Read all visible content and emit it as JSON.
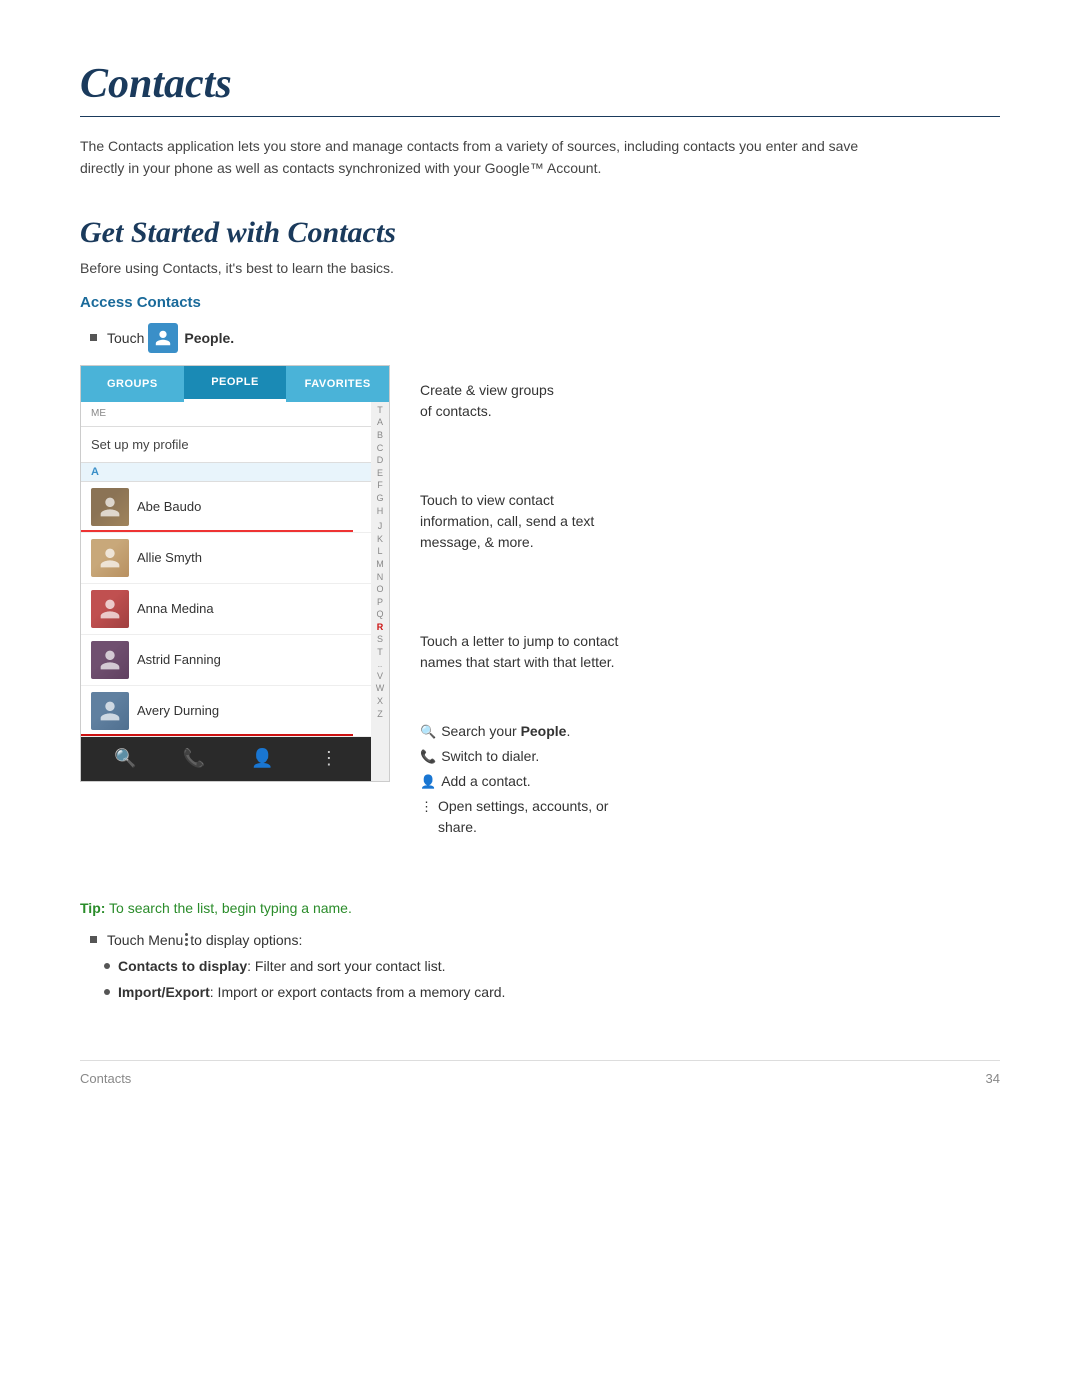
{
  "page": {
    "title": "Contacts",
    "intro": "The Contacts application lets you store and manage contacts from a variety of sources, including contacts you enter and save directly in your phone as well as contacts synchronized with your Google™ Account.",
    "section_title": "Get Started with Contacts",
    "section_intro": "Before using Contacts, it's best to learn the basics.",
    "subsection_heading": "Access Contacts",
    "touch_people_text": "Touch",
    "touch_people_bold": "People.",
    "footer_label": "Contacts",
    "footer_page": "34"
  },
  "tabs": [
    {
      "label": "GROUPS",
      "active": false
    },
    {
      "label": "PEOPLE",
      "active": true
    },
    {
      "label": "FAVORITES",
      "active": false
    }
  ],
  "index_letters": [
    "T",
    "",
    "A",
    "B",
    "C",
    "D",
    "E",
    "F",
    "G",
    "H",
    "",
    "J",
    "K",
    "L",
    "M",
    "N",
    "O",
    "P",
    "Q",
    "R",
    "S",
    "T",
    "..",
    "",
    "V",
    "W",
    "X",
    "",
    "Z"
  ],
  "contacts": [
    {
      "name": "Abe Baudo",
      "avatar": "abe",
      "has_red_line": true
    },
    {
      "name": "Allie Smyth",
      "avatar": "allie",
      "has_red_line": false
    },
    {
      "name": "Anna Medina",
      "avatar": "anna",
      "has_red_line": false
    },
    {
      "name": "Astrid Fanning",
      "avatar": "astrid",
      "has_red_line": false
    },
    {
      "name": "Avery Durning",
      "avatar": "avery",
      "has_red_line": true
    }
  ],
  "callouts": [
    {
      "id": "callout-groups",
      "text": "Create & view groups\nof contacts.",
      "position": "top"
    },
    {
      "id": "callout-contact",
      "text": "Touch to view contact\ninformation, call, send a text\nmessage, & more.",
      "position": "middle"
    },
    {
      "id": "callout-letter",
      "text": "Touch a letter to jump to contact\nnames that start with that letter.",
      "position": "middle-lower"
    },
    {
      "id": "callout-bottom",
      "lines": [
        {
          "text": "Search your ",
          "bold": "People",
          "after": "."
        },
        {
          "text": "Switch to dialer.",
          "bold": ""
        },
        {
          "text": "Add a contact.",
          "bold": ""
        },
        {
          "text": "Open settings, accounts, or\nshare.",
          "bold": ""
        }
      ],
      "position": "bottom"
    }
  ],
  "tip": {
    "label": "Tip:",
    "text": " To search the list, begin typing a name."
  },
  "menu_item": {
    "prefix": "Touch Menu",
    "suffix": "to display options:"
  },
  "sub_bullets": [
    {
      "bold": "Contacts to display",
      "text": ": Filter and sort your contact list."
    },
    {
      "bold": "Import/Export",
      "text": ": Import or export contacts from a memory card."
    }
  ],
  "setup_profile_text": "Set up my profile",
  "me_label": "ME",
  "section_letter_a": "A"
}
